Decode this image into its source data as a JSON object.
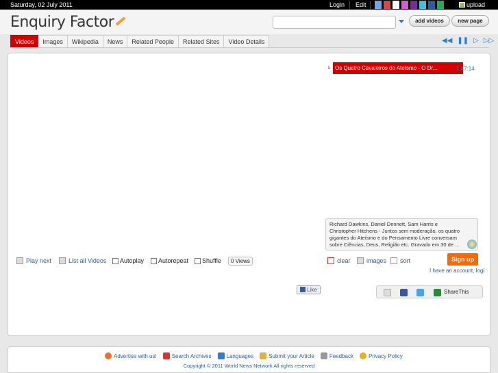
{
  "topbar": {
    "date": "Saturday, 02 July 2011",
    "login": "Login",
    "edit": "Edit",
    "swatches": [
      "#6aa8e8",
      "#d94848",
      "#ffffff",
      "#d060d0",
      "#7a2a9a",
      "#3fc0d8",
      "#2a5aa8",
      "#2aa85a"
    ],
    "upload": "upload"
  },
  "header": {
    "title": "Enquiry Factor",
    "search_value": "",
    "add_videos": "add videos",
    "new_page": "new page"
  },
  "tabs": [
    "Videos",
    "Images",
    "Wikipedia",
    "News",
    "Related People",
    "Related Sites",
    "Video Details"
  ],
  "media_controls": [
    "rewind-icon",
    "pause-icon",
    "play-icon",
    "fast-forward-icon"
  ],
  "playlist": {
    "num": "1",
    "title": "Os Quatro Cavaleiros do Ateísmo - O Dr...",
    "duration": "1:47:14"
  },
  "description": "Richard Dawkins, Daniel Dennett, Sam Harris e Christopher Hitchens - Juntos sem moderação, os quatro gigantes do Ateísmo e do Pensamento Livre conversam sobre Ciências, Deus, Religião etc. Gravado em 30 de ...",
  "controls": {
    "play_next": "Play next",
    "list_all": "List all Videos",
    "autoplay": "Autoplay",
    "autorepeat": "Autorepeat",
    "shuffle": "Shuffle",
    "views": "0 Views",
    "clear": "clear",
    "images": "images",
    "sort": "sort"
  },
  "account": {
    "signup": "Sign up",
    "have_account": "I have an account, logi"
  },
  "social": {
    "like": "Like",
    "sharethis": "ShareThis"
  },
  "footer": {
    "links": [
      "Advertise with us!",
      "Search Archives",
      "Languages",
      "Submit your Article",
      "Feedback",
      "Privacy Policy"
    ],
    "copyright": "Copyright © 2011 World News Network All rights reserved"
  }
}
